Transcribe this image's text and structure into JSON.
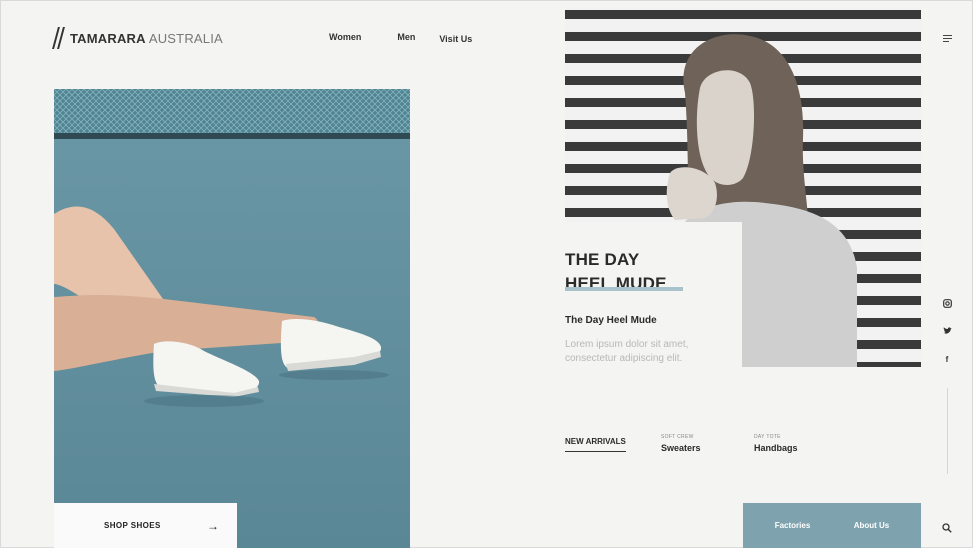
{
  "brand": {
    "name_bold": "TAMARARA",
    "name_light": "AUSTRALIA"
  },
  "nav": {
    "items": [
      "Women",
      "Men",
      "Visit Us"
    ]
  },
  "hero": {
    "headline_line1": "THE DAY",
    "headline_line2": "HEEL MUDE",
    "subheading": "The Day Heel Mude",
    "description": "Lorem ipsum dolor sit amet, consectetur adipiscing elit."
  },
  "shop_button": {
    "label": "SHOP SHOES",
    "arrow": "→"
  },
  "categories": {
    "new_arrivals": "NEW ARRIVALS",
    "sweaters_small": "SOFT CREW",
    "sweaters": "Sweaters",
    "handbags_small": "DAY TOTE",
    "handbags": "Handbags"
  },
  "footer": {
    "factories": "Factories",
    "about": "About Us"
  },
  "social": {
    "instagram_icon": "instagram-icon",
    "twitter_icon": "twitter-icon",
    "facebook_icon": "facebook-icon",
    "facebook_glyph": "f"
  },
  "colors": {
    "accent": "#7fa3ae",
    "highlight": "#a8c3cc",
    "court": "#5f8b99"
  }
}
